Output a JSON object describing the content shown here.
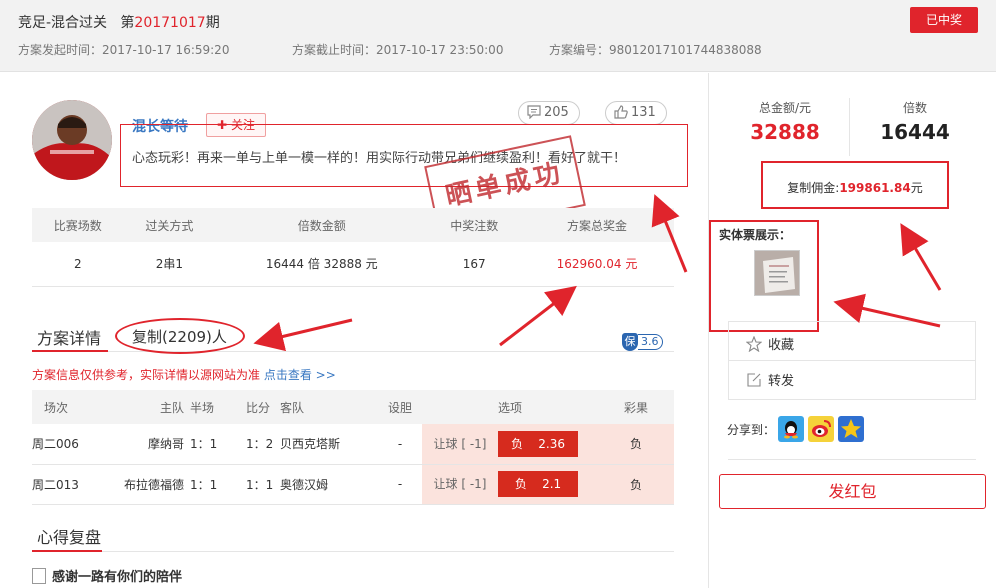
{
  "header": {
    "title_prefix": "竞足-混合过关",
    "issue_prefix": "第",
    "issue_number": "20171017",
    "issue_suffix": "期",
    "start_time": "方案发起时间：2017-10-17 16:59:20",
    "end_time": "方案截止时间：2017-10-17 23:50:00",
    "plan_number": "方案编号：98012017101744838088",
    "status_button": "已中奖"
  },
  "author": {
    "name": "混长等待",
    "follow_label": "关注",
    "follow_plus": "✚",
    "comments": "205",
    "likes": "131",
    "description": "心态玩彩！再来一单与上单一模一样的！用实际行动带兄弟们继续盈利！看好了就干！",
    "stamp_text": "晒单成功"
  },
  "summary": {
    "headers": [
      "比赛场数",
      "过关方式",
      "倍数金额",
      "中奖注数",
      "方案总奖金"
    ],
    "row": [
      "2",
      "2串1",
      "16444 倍  32888 元",
      "167",
      "162960.04 元"
    ]
  },
  "tabs": {
    "detail": "方案详情",
    "copy": "复制(2209)人",
    "bao_icon": "保",
    "bao_value": "3.6"
  },
  "notice": {
    "text": "方案信息仅供参考，实际详情以源网站为准",
    "link": "点击查看 >>"
  },
  "matches": {
    "headers": [
      "场次",
      "主队",
      "半场",
      "比分",
      "客队",
      "设胆",
      "选项",
      "彩果"
    ],
    "rows": [
      {
        "id": "周二006",
        "home": "摩纳哥",
        "half": "1：1",
        "score": "1：2",
        "away": "贝西克塔斯",
        "banker": "-",
        "handicap": "让球 [ -1]",
        "pick": "负",
        "odds": "2.36",
        "result": "负"
      },
      {
        "id": "周二013",
        "home": "布拉德福德",
        "half": "1：1",
        "score": "1：1",
        "away": "奥德汉姆",
        "banker": "-",
        "handicap": "让球 [ -1]",
        "pick": "负",
        "odds": "2.1",
        "result": "负"
      }
    ]
  },
  "xinde": {
    "title": "心得复盘",
    "item": "感谢一路有你们的陪伴"
  },
  "sidebar": {
    "total_label": "总金额/元",
    "total_value": "32888",
    "multiple_label": "倍数",
    "multiple_value": "16444",
    "commission_prefix": "复制佣金:",
    "commission_value": "199861.84",
    "commission_suffix": "元",
    "ticket_label": "实体票展示：",
    "favorite_label": "收藏",
    "forward_label": "转发",
    "share_label": "分享到：",
    "hongbao_label": "发红包"
  },
  "colors": {
    "accent": "#e0242c",
    "link": "#3a78c2",
    "pick_bg": "#fbe3dd",
    "odds_bg": "#d62b1e"
  }
}
